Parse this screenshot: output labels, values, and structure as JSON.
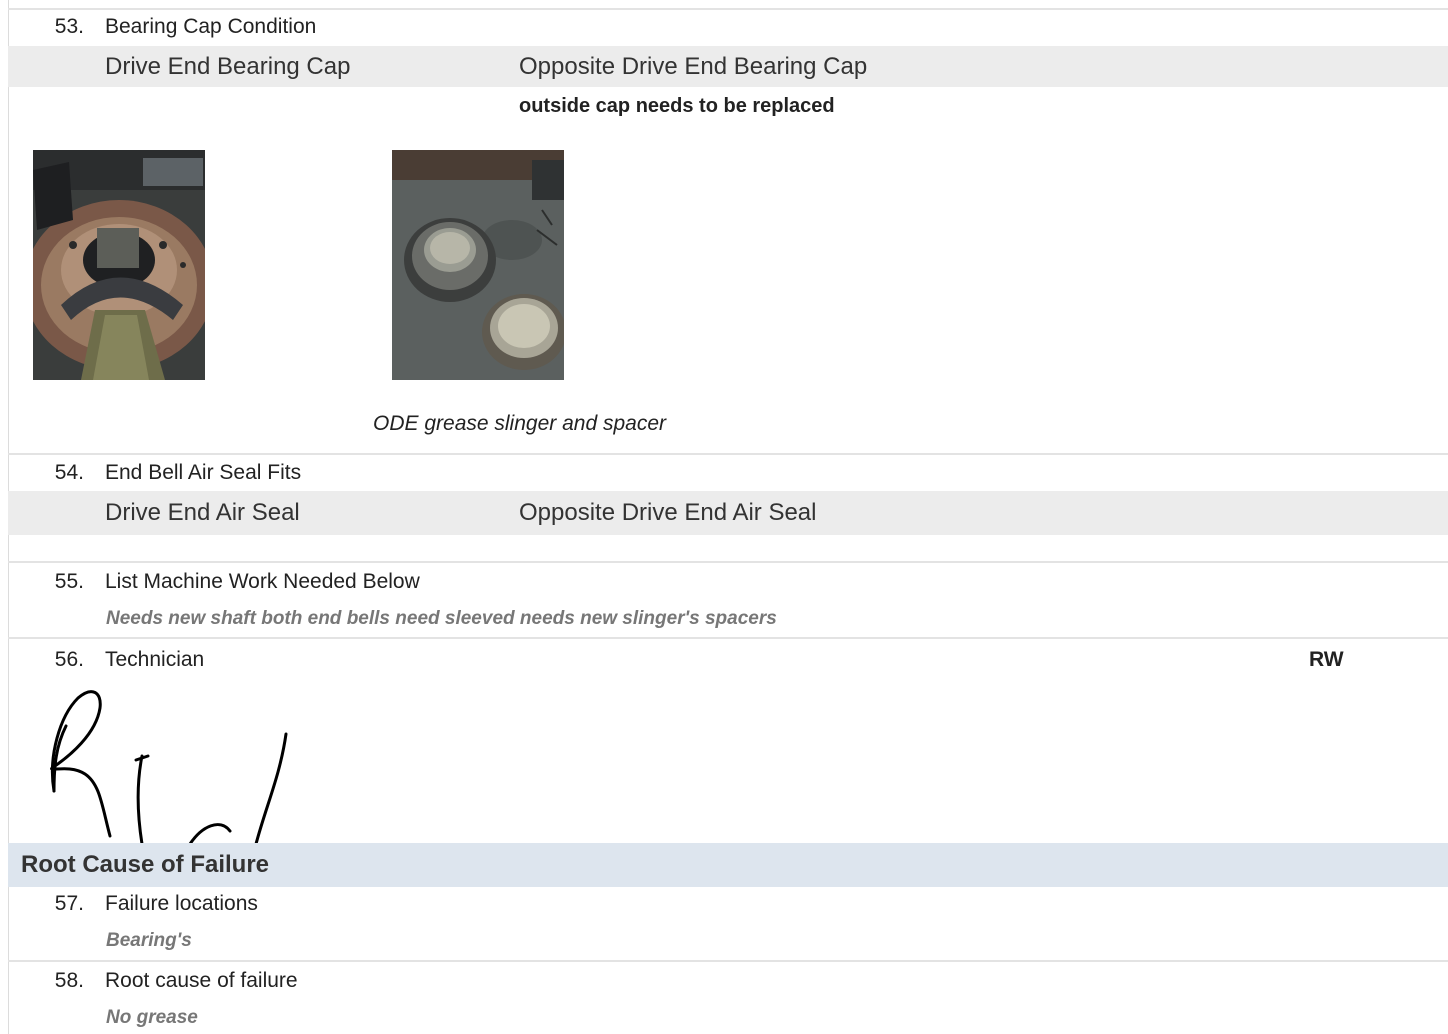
{
  "items": {
    "q53": {
      "number": "53.",
      "label": "Bearing Cap Condition",
      "de_label": "Drive End Bearing Cap",
      "ode_label": "Opposite Drive End Bearing Cap",
      "ode_value": "outside cap needs to be replaced",
      "photo_caption": "ODE grease slinger and spacer"
    },
    "q54": {
      "number": "54.",
      "label": "End Bell Air Seal Fits",
      "de_label": "Drive End Air Seal",
      "ode_label": "Opposite Drive End Air Seal"
    },
    "q55": {
      "number": "55.",
      "label": "List Machine Work Needed Below",
      "answer": "Needs new shaft both end bells need sleeved needs new slinger's spacers"
    },
    "q56": {
      "number": "56.",
      "label": "Technician",
      "value": "RW"
    }
  },
  "section": {
    "title": "Root Cause of Failure"
  },
  "items2": {
    "q57": {
      "number": "57.",
      "label": "Failure locations",
      "answer": "Bearing's"
    },
    "q58": {
      "number": "58.",
      "label": "Root cause of failure",
      "answer": "No grease"
    }
  }
}
